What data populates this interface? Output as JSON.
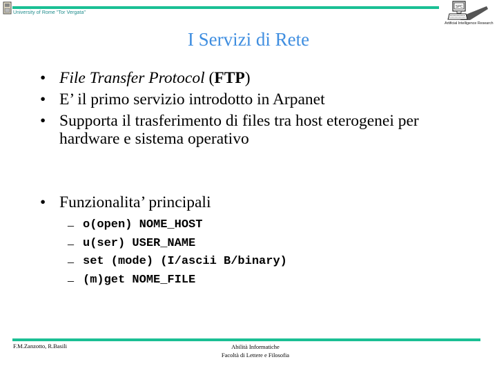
{
  "header": {
    "university_name": "University of Rome \"Tor Vergata\"",
    "logo_caption": "Artificial Intelligence Research",
    "screen_label": "SPC"
  },
  "slide": {
    "title": "I Servizi di Rete",
    "bullets": [
      {
        "italic": "File Transfer Protocol",
        "plain": " (",
        "bold": "FTP",
        "suffix": ")"
      },
      {
        "text": "E’ il primo servizio introdotto in Arpanet"
      },
      {
        "text": "Supporta il trasferimento di files tra host eterogenei per hardware e sistema operativo"
      }
    ],
    "main_bullet": "Funzionalita’ principali",
    "subitems": [
      "o(open) NOME_HOST",
      "u(ser) USER_NAME",
      "set (mode) (I/ascii B/binary)",
      "(m)get NOME_FILE"
    ],
    "bullet_symbol": "•",
    "dash_symbol": "–"
  },
  "footer": {
    "authors": "F.M.Zanzotto, R.Basili",
    "course": "Abilità Informatiche",
    "faculty": "Facoltà di Lettere e Filosofia"
  },
  "colors": {
    "rule": "#1abf94",
    "title": "#3f8ee0",
    "university_text": "#1a8a8a"
  }
}
